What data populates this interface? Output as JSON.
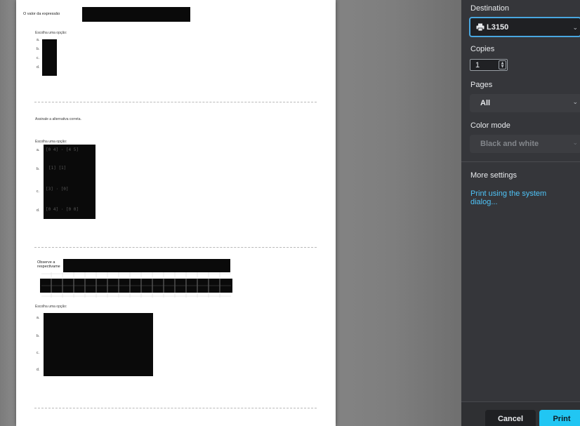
{
  "preview": {
    "q1": {
      "prompt": "O valor da expressão",
      "choose": "Escolha uma opção:",
      "options": [
        "a.",
        "b.",
        "c.",
        "d."
      ]
    },
    "q2": {
      "prompt": "Assinale a alternativa correta.",
      "choose": "Escolha uma opção:",
      "options": [
        "a.",
        "b.",
        "c.",
        "d."
      ],
      "matrices": [
        "[0 4]  ·  [4 5]",
        "[1]   [1]",
        "[3]  · [0]",
        "[0 4]  ·  [0 0]"
      ]
    },
    "q3": {
      "prompt_line1": "Observe a",
      "prompt_line2": "respectivame",
      "choose": "Escolha uma opção:",
      "options": [
        "a.",
        "b.",
        "c.",
        "d."
      ]
    }
  },
  "panel": {
    "destination_label": "Destination",
    "destination_value": "L3150",
    "copies_label": "Copies",
    "copies_value": "1",
    "pages_label": "Pages",
    "pages_value": "All",
    "color_label": "Color mode",
    "color_value": "Black and white",
    "more_settings": "More settings",
    "system_dialog_link": "Print using the system dialog...",
    "cancel": "Cancel",
    "print": "Print"
  },
  "colors": {
    "accent": "#21c6f3",
    "panel_bg": "#35363a",
    "link": "#4fc3f7"
  },
  "icons": {
    "printer": "printer-icon",
    "chevron": "chevron-down-icon"
  }
}
